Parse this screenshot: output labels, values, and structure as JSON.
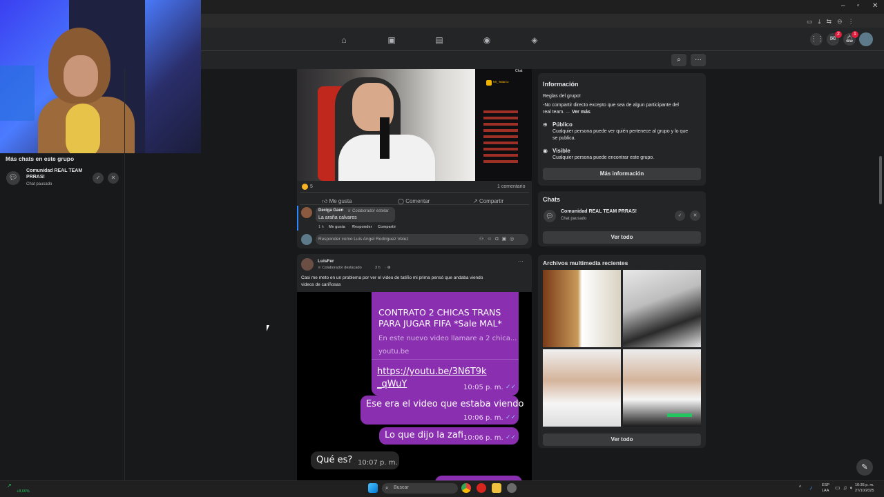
{
  "left": {
    "section_title": "Más chats en este grupo",
    "chat": {
      "name_line1": "Comunidad REAL TEAM",
      "name_line2": "PRRAS!",
      "status": "Chat pausado"
    }
  },
  "post1": {
    "reactions_count": "5",
    "comments_count": "1 comentario",
    "actions": {
      "like": "Me gusta",
      "comment": "Comentar",
      "share": "Compartir"
    },
    "comment": {
      "author": "Deciga Gaen",
      "badge": "Colaborador estelar",
      "text": "La araña calvares",
      "time": "1 h",
      "like": "Me gusta",
      "reply": "Responder",
      "share": "Compartir"
    },
    "reply_placeholder": "Responder como Luis Angel Rodriguez Velez"
  },
  "post2": {
    "author": "LuisFer",
    "badge": "Colaborador destacado",
    "time": "3 h",
    "text_line1": "Casi me meto en un problema por ver el video de tatiño mi prima pensó que andaba viendo",
    "text_line2": "videos de cariñosas",
    "chat": {
      "link_title_line1": "CONTRATO 2 CHICAS TRANS",
      "link_title_line2": "PARA JUGAR FIFA *Sale MAL*",
      "link_desc": "En este nuevo video llamare a 2 chica...",
      "link_domain": "youtu.be",
      "url_line1": "https://youtu.be/3N6T9k",
      "url_line2": "_qWuY",
      "time1": "10:05 p. m.",
      "msg2": "Ese era el video que estaba viendo",
      "time2": "10:06 p. m.",
      "msg3": "Lo que dijo la zafi",
      "time3": "10:06 p. m.",
      "msg4": "Qué es?",
      "time4": "10:07 p. m."
    }
  },
  "info": {
    "title": "Información",
    "rules_title": "Reglas del grupo!",
    "rules_line1": "-No compartir directo excepto que sea de algun participante del",
    "rules_line2": "real team. ...",
    "see_more": "Ver más",
    "public_title": "Público",
    "public_line1": "Cualquier persona puede ver quién pertenece al grupo y lo que",
    "public_line2": "se publica.",
    "visible_title": "Visible",
    "visible_desc": "Cualquier persona puede encontrar este grupo.",
    "more_button": "Más información"
  },
  "chats": {
    "title": "Chats",
    "chat_name": "Comunidad REAL TEAM PRRAS!",
    "chat_status": "Chat pausado",
    "see_all": "Ver todo"
  },
  "media": {
    "title": "Archivos multimedia recientes",
    "see_all": "Ver todo"
  },
  "stream_chat": {
    "header": "Chat",
    "user": "Mr_Tatarco"
  },
  "nav": {
    "messenger_badge": "2",
    "notif_badge": "1"
  },
  "taskbar": {
    "search_placeholder": "Buscar",
    "lang_line1": "ESP",
    "lang_line2": "LAA",
    "time": "10:35 p. m.",
    "date": "27/10/2025",
    "stock_value": "+8,66%"
  },
  "colors": {
    "bg": "#18191a",
    "card": "#242526",
    "purple_bubble": "#8a2fb0",
    "accent_blue": "#2d88ff"
  }
}
